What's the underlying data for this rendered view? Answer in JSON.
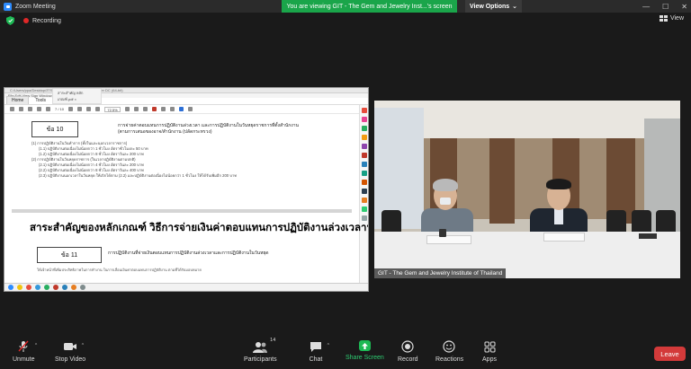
{
  "window": {
    "title": "Zoom Meeting"
  },
  "share_banner": {
    "text": "You are viewing GIT - The Gem and Jewelry Inst...'s screen"
  },
  "view_options": {
    "label": "View Options",
    "caret": "⌄"
  },
  "window_controls": {
    "minimize": "—",
    "maximize": "☐",
    "close": "✕"
  },
  "recording": {
    "label": "Recording"
  },
  "view_button": {
    "label": "View"
  },
  "shared_doc": {
    "url_text": "C:/Users/ppa/Desktop/สาระสำคัญ... Adobe Acrobat Reader DC (64-bit)",
    "menu_text": "File   Edit   View   Sign   Window   Help",
    "tabs": [
      {
        "label": "Home"
      },
      {
        "label": "Tools"
      }
    ],
    "file_tab": "สาระสำคัญ หลักเกณฑ์.pdf  ×",
    "page_indicator": "7  /  10",
    "zoom": "72.5%",
    "clause10": {
      "label": "ข้อ 10",
      "title_line1": "การจ่ายค่าตอบแทนการปฏิบัติงานล่วงเวลา และการปฏิบัติงานในวันหยุดราชการที่ตั้งสำนักงาน",
      "title_line2": "(ตามการเสนอของอาจ/สำนักงาน (ปลัดกระทรวง)",
      "lines": [
        "(1) การปฏิบัติงานในวันทำการ (ทั้งในและนอกเวลาราชการ)",
        "(1.1) ปฏิบัติงานต่อเนื่องไม่น้อยกว่า 1 ชั่วโมง อัตราชั่วโมงละ 50 บาท",
        "(1.2) ปฏิบัติงานต่อเนื่องไม่น้อยกว่า 8 ชั่วโมง อัตราวันละ 200 บาท",
        "(2) การปฏิบัติงานในวันหยุดราชการ (ในเวลาปฏิบัติงานตามปกติ)",
        "(2.1) ปฏิบัติงานต่อเนื่องไม่น้อยกว่า 4 ชั่วโมง อัตราวันละ 200 บาท",
        "(2.2) ปฏิบัติงานต่อเนื่องไม่น้อยกว่า 8 ชั่วโมง อัตราวันละ 400 บาท",
        "(2.3) ปฏิบัติงานนอกเวลาในวันหยุด ให้เบิกได้ตาม (2.2) และปฏิบัติงานต่อเนื่องไม่น้อยกว่า 1 ชั่วโมง ให้ได้รับเพิ่มอีก 200 บาท"
      ]
    },
    "heading": "สาระสำคัญของหลักเกณฑ์ วิธีการจ่ายเงินค่าตอบแทนการปฏิบัติงานล่วงเวลาฯ",
    "clause11": {
      "label": "ข้อ 11",
      "title": "การปฏิบัติงานที่จ่ายเงินตอบแทนการปฏิบัติงานล่วงเวลาและการปฏิบัติงานในวันหยุด",
      "body": "ให้เจ้าหน้าที่เพิ่มประสิทธิภาพในการทำงาน ในการเลื่อนเงินค่าตอบแทนการปฏิบัติงาน ตามที่ได้รับมอบหมาย"
    }
  },
  "video": {
    "participant_name": "GIT - The Gem and Jewelry Institute of Thailand"
  },
  "toolbar": {
    "unmute": "Unmute",
    "stop_video": "Stop Video",
    "participants": "Participants",
    "participants_count": "14",
    "chat": "Chat",
    "share_screen": "Share Screen",
    "record": "Record",
    "reactions": "Reactions",
    "apps": "Apps",
    "end": "Leave"
  },
  "colors": {
    "share_green": "#1aa54a",
    "end_red": "#d33a3a",
    "recording_red": "#e02828"
  }
}
